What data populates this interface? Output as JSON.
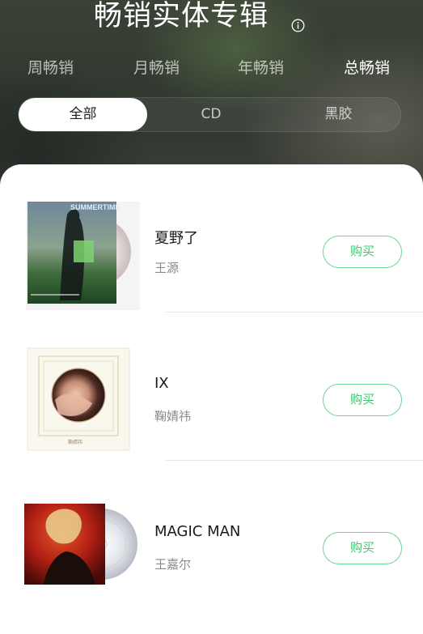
{
  "header": {
    "title": "畅销实体专辑",
    "info_icon": "info-circle-icon",
    "period_tabs": [
      {
        "label": "周畅销",
        "active": false
      },
      {
        "label": "月畅销",
        "active": false
      },
      {
        "label": "年畅销",
        "active": false
      },
      {
        "label": "总畅销",
        "active": true
      }
    ],
    "filters": [
      {
        "label": "全部",
        "active": true
      },
      {
        "label": "CD",
        "active": false
      },
      {
        "label": "黑胶",
        "active": false
      }
    ]
  },
  "albums": [
    {
      "title": "夏野了",
      "artist": "王源",
      "buy_label": "购买",
      "cover_text": "SUMMERTIME",
      "cover_icon": "album-cover-cd"
    },
    {
      "title": "IX",
      "artist": "鞠婧祎",
      "buy_label": "购买",
      "cover_text": "鞠婧祎",
      "cover_icon": "album-cover-portrait"
    },
    {
      "title": "MAGIC MAN",
      "artist": "王嘉尔",
      "buy_label": "购买",
      "cover_icon": "album-cover-vinyl"
    }
  ],
  "colors": {
    "accent": "#45c473",
    "accent_border": "#6ad692",
    "header_bg": "#2f362f",
    "panel_bg": "#ffffff"
  }
}
